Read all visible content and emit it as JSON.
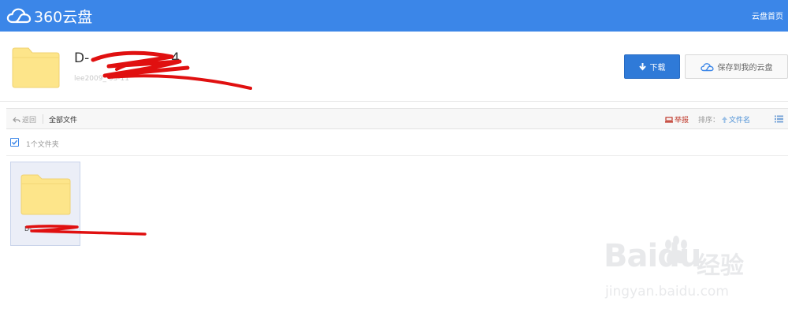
{
  "topbar": {
    "logo_text": "360云盘",
    "home_link": "云盘首页"
  },
  "share": {
    "title_prefix": "D-",
    "title_suffix": "4",
    "meta": "lee2009_                 03-11",
    "download_label": "下载",
    "save_label": "保存到我的云盘"
  },
  "toolbar": {
    "back_label": "返回",
    "all_files_label": "全部文件",
    "report_label": "举报",
    "sort_label": "排序：",
    "sort_value": "文件名"
  },
  "selection": {
    "count_label": "1个文件夹"
  },
  "files": [
    {
      "name": "D-"
    }
  ],
  "watermark": {
    "brand": "Baidu",
    "cn": "经验",
    "url": "jingyan.baidu.com"
  },
  "colors": {
    "topbar": "#3b86e8",
    "primary_button": "#2f7ad8",
    "folder": "#fde58a",
    "report": "#c0392b",
    "redaction": "#e01010"
  }
}
